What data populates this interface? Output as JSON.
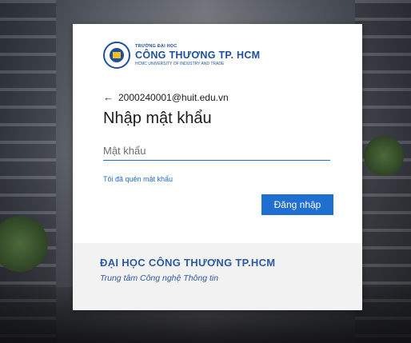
{
  "logo": {
    "line1": "TRƯỜNG ĐẠI HỌC",
    "line2": "CÔNG THƯƠNG TP. HCM",
    "line3": "HCMC UNIVERSITY OF INDUSTRY AND TRADE"
  },
  "account": {
    "back_arrow": "←",
    "email": "2000240001@huit.edu.vn"
  },
  "page_title": "Nhập mật khẩu",
  "password_field": {
    "placeholder": "Mật khẩu",
    "value": ""
  },
  "forgot_link": "Tôi đã quên mật khẩu",
  "signin_button": "Đăng nhập",
  "footer": {
    "org_name": "ĐẠI HỌC CÔNG THƯƠNG TP.HCM",
    "dept_name": "Trung tâm Công nghệ Thông tin"
  },
  "colors": {
    "accent": "#1f6fd0",
    "brand": "#2b5aa3"
  }
}
